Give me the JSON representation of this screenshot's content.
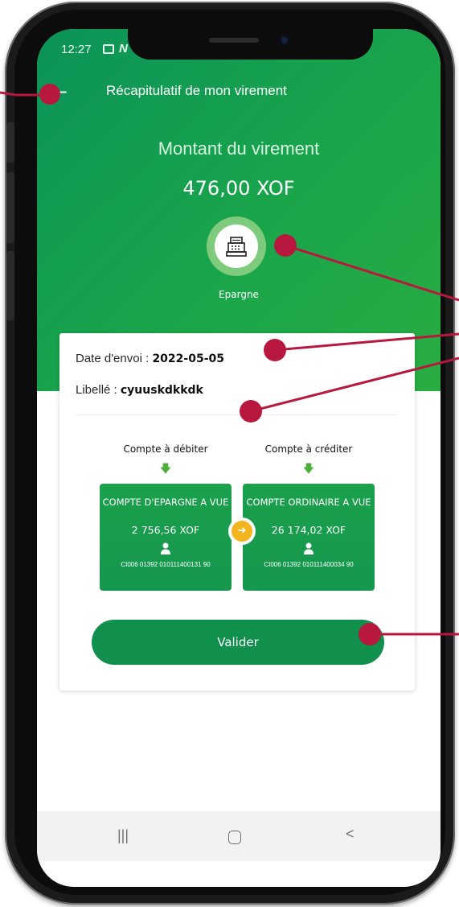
{
  "status_bar": {
    "time": "12:27",
    "icons": [
      "gallery-icon",
      "n-icon",
      "signal-icon",
      "battery-icon"
    ]
  },
  "header": {
    "back_symbol": "←",
    "title": "Récapitulatif de mon virement"
  },
  "transfer": {
    "amount_label": "Montant du virement",
    "amount": "476,00 XOF",
    "type_icon": "cash-register-icon",
    "type_label": "Epargne"
  },
  "details": {
    "date_label": "Date d'envoi :",
    "date_value": "2022-05-05",
    "label_label": "Libellé :",
    "label_value": "cyuuskdkkdk"
  },
  "debit": {
    "heading": "Compte à débiter",
    "account_name": "COMPTE D'EPARGNE A VUE",
    "balance": "2 756,56 XOF",
    "number": "CI006 01392 010111400131 90"
  },
  "credit": {
    "heading": "Compte à créditer",
    "account_name": "COMPTE ORDINAIRE A VUE",
    "balance": "26 174,02 XOF",
    "number": "CI006 01392 010111400034 90"
  },
  "actions": {
    "validate_label": "Valider"
  },
  "nav": {
    "recents": "|||",
    "back": "<"
  },
  "colors": {
    "primary": "#108f4d",
    "hero_start": "#0b9358",
    "hero_end": "#29ad42",
    "accent": "#f2b51d",
    "callout": "#b8183e"
  }
}
